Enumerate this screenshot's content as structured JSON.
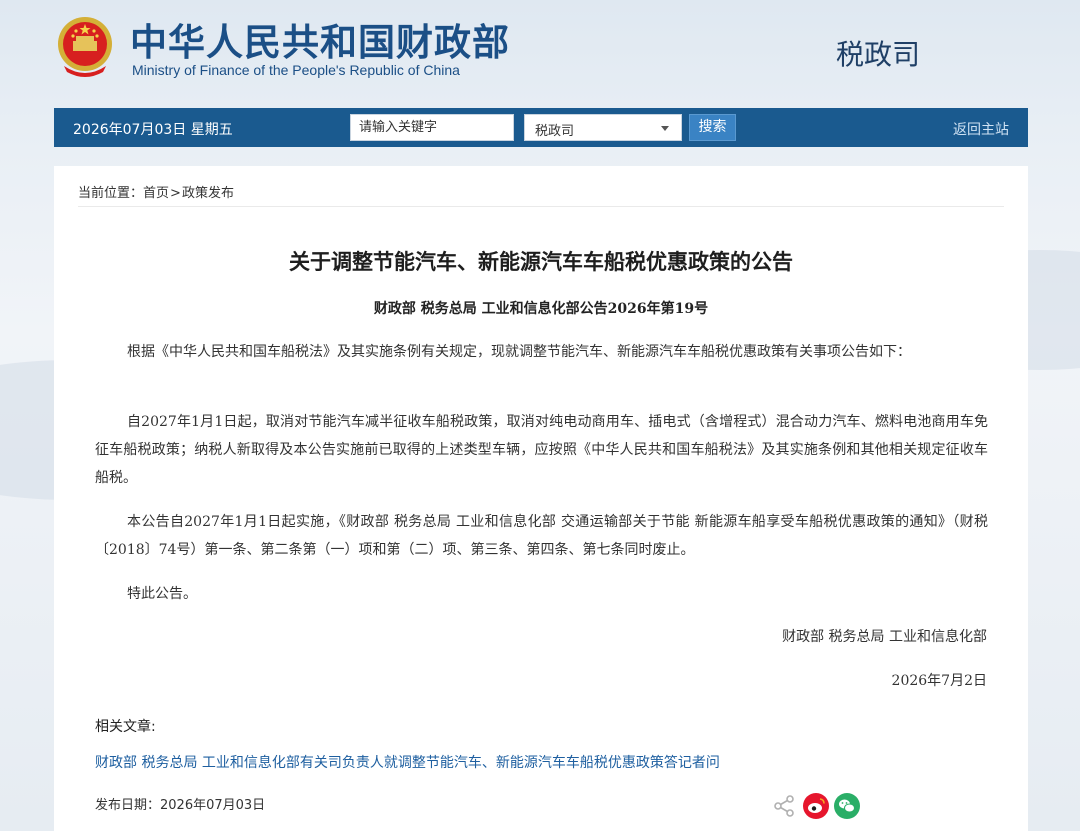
{
  "header": {
    "title_cn": "中华人民共和国财政部",
    "title_en": "Ministry of Finance of the People's Republic of China",
    "department": "税政司",
    "emblem_icon": "national-emblem-icon"
  },
  "navbar": {
    "date": "2026年07月03日  星期五",
    "search_placeholder": "请输入关键字",
    "select_value": "税政司",
    "search_label": "搜索",
    "home_label": "返回主站"
  },
  "breadcrumb": {
    "prefix": "当前位置：",
    "home": "首页",
    "separator": ">",
    "section": "政策发布"
  },
  "article": {
    "title": "关于调整节能汽车、新能源汽车车船税优惠政策的公告",
    "doc_number": "财政部  税务总局  工业和信息化部公告2026年第19号",
    "paragraphs": [
      "根据《中华人民共和国车船税法》及其实施条例有关规定，现就调整节能汽车、新能源汽车车船税优惠政策有关事项公告如下：",
      "自2027年1月1日起，取消对节能汽车减半征收车船税政策，取消对纯电动商用车、插电式（含增程式）混合动力汽车、燃料电池商用车免征车船税政策；纳税人新取得及本公告实施前已取得的上述类型车辆，应按照《中华人民共和国车船税法》及其实施条例和其他相关规定征收车船税。",
      "本公告自2027年1月1日起实施，《财政部  税务总局  工业和信息化部  交通运输部关于节能  新能源车船享受车船税优惠政策的通知》（财税〔2018〕74号）第一条、第二条第（一）项和第（二）项、第三条、第四条、第七条同时废止。",
      "特此公告。"
    ],
    "signature": "财政部  税务总局  工业和信息化部",
    "date": "2026年7月2日"
  },
  "related": {
    "title": "相关文章:",
    "links": [
      "财政部 税务总局 工业和信息化部有关司负责人就调整节能汽车、新能源汽车车船税优惠政策答记者问"
    ]
  },
  "publish": {
    "label": "发布日期：",
    "date": "2026年07月03日"
  },
  "share": {
    "icons": [
      "share-icon",
      "weibo-icon",
      "wechat-icon"
    ],
    "colors": {
      "weibo": "#e6162d",
      "wechat": "#2aae67",
      "generic": "#b0b0b0"
    }
  },
  "colors": {
    "nav": "#1a5a8f",
    "brand": "#1b4f86",
    "button": "#3a83c4",
    "link": "#1e5fa0"
  }
}
